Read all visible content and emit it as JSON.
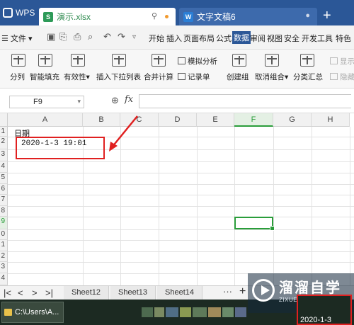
{
  "titlebar": {
    "app_name": "WPS",
    "tabs": [
      {
        "label": "演示.xlsx",
        "icon": "spreadsheet-icon",
        "active": true
      },
      {
        "label": "文字文稿6",
        "icon": "writer-doc-icon",
        "active": false
      }
    ],
    "new_tab_glyph": "+"
  },
  "menubar": {
    "file_label": "文件",
    "items": [
      "开始",
      "插入",
      "页面布局",
      "公式",
      "数据",
      "审阅",
      "视图",
      "安全",
      "开发工具",
      "特色"
    ],
    "active_item": "数据"
  },
  "ribbon": {
    "split_label": "分列",
    "smart_fill_label": "智能填充",
    "validity_label": "有效性",
    "insert_dropdown_label": "插入下拉列表",
    "consolidate_label": "合并计算",
    "what_if_label": "模拟分析",
    "record_label": "记录单",
    "create_group_label": "创建组",
    "ungroup_label": "取消组合",
    "subtotal_label": "分类汇总",
    "show_detail_label": "显示",
    "hide_detail_label": "隐藏"
  },
  "formula_bar": {
    "name_box": "F9",
    "fx_label": "fx",
    "formula_value": ""
  },
  "grid": {
    "columns": [
      "A",
      "B",
      "C",
      "D",
      "E",
      "F",
      "G",
      "H"
    ],
    "rows": [
      "1",
      "2",
      "3",
      "4",
      "5",
      "6",
      "7",
      "8",
      "9",
      "0",
      "1",
      "2",
      "3",
      "4"
    ],
    "selected_column": "F",
    "selected_row": "9",
    "cells": {
      "A1": "日期",
      "A2": "2020-1-3 19:01"
    }
  },
  "sheets": {
    "tabs": [
      "Sheet12",
      "Sheet13",
      "Sheet14"
    ],
    "more_glyph": "···",
    "add_glyph": "+"
  },
  "taskbar": {
    "explorer_label": "C:\\Users\\A...",
    "tray_date": "2020-1-3"
  },
  "watermark": {
    "title": "溜溜自学",
    "subtitle": "ZIXUE.3D66.COM"
  },
  "colors": {
    "titlebar": "#2b5797",
    "accent_green": "#2a9d3a",
    "annotation_red": "#e02020"
  }
}
